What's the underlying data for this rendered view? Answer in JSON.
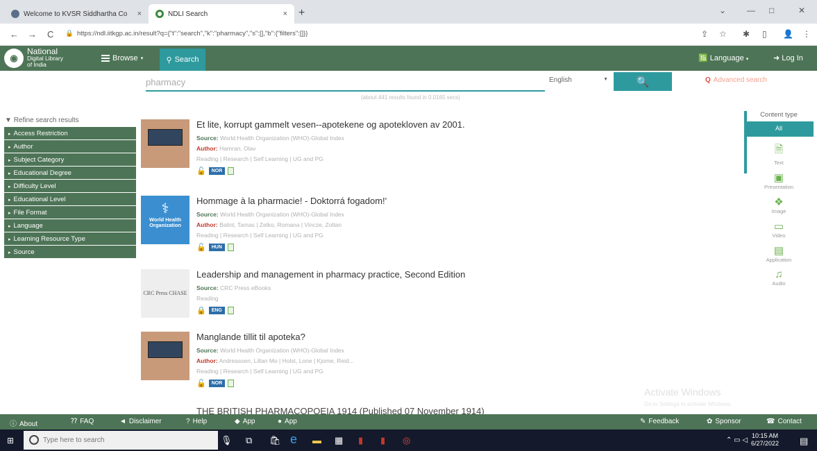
{
  "browser": {
    "tabs": [
      {
        "title": "Welcome to KVSR Siddhartha Co",
        "close": "×"
      },
      {
        "title": "NDLI Search",
        "close": "×"
      }
    ],
    "new_tab": "+",
    "url": "https://ndl.iitkgp.ac.in/result?q={\"t\":\"search\",\"k\":\"pharmacy\",\"s\":[],\"b\":{\"filters\":[]}}",
    "back": "←",
    "forward": "→",
    "reload": "C"
  },
  "header": {
    "logo_line1": "National",
    "logo_line2": "Digital Library",
    "logo_line3": "of India",
    "browse": "Browse",
    "search_tab": "Search",
    "language": "Language",
    "login": "Log In"
  },
  "search": {
    "query": "pharmacy",
    "language": "English",
    "advanced": "Advanced search",
    "results_info": "(about 441 results found in 0.0165 secs)"
  },
  "sidebar": {
    "title": "Refine search results",
    "facets": [
      "Access Restriction",
      "Author",
      "Subject Category",
      "Educational Degree",
      "Difficulty Level",
      "Educational Level",
      "File Format",
      "Language",
      "Learning Resource Type",
      "Source"
    ]
  },
  "results": [
    {
      "title": "Et lite, korrupt gammelt vesen--apotekene og apotekloven av 2001.",
      "source_label": "Source:",
      "source": "World Health Organization (WHO)-Global Index",
      "author_label": "Author:",
      "author": "Hamran, Olav",
      "tags": "Reading | Research | Self Learning | UG and PG",
      "lang": "NOR",
      "locked": false
    },
    {
      "title": "Hommage à la pharmacie! - Doktorrá fogadom!'",
      "source_label": "Source:",
      "source": "World Health Organization (WHO)-Global Index",
      "author_label": "Author:",
      "author": "Balint, Tamas | Zelko, Romana | Vincze, Zoltan",
      "tags": "Reading | Research | Self Learning | UG and PG",
      "lang": "HUN",
      "locked": false
    },
    {
      "title": "Leadership and management in pharmacy practice, Second Edition",
      "source_label": "Source:",
      "source": "CRC Press eBooks",
      "tags": "Reading",
      "lang": "ENG",
      "locked": true
    },
    {
      "title": "Manglande tillit til apoteka?",
      "source_label": "Source:",
      "source": "World Health Organization (WHO)-Global Index",
      "author_label": "Author:",
      "author": "Andreassen, Lillan Mo | Holst, Lone | Kjome, Reid...",
      "tags": "Reading | Research | Self Learning | UG and PG",
      "lang": "NOR",
      "locked": false
    }
  ],
  "partial_result_title": "THE BRITISH PHARMACOPOEIA 1914 (Published 07 November 1914)",
  "thumbs": {
    "who_text": "World Health Organization",
    "crc_text": "CRC Press CHASE"
  },
  "content_type": {
    "title": "Content type",
    "all": "All",
    "items": [
      {
        "label": "Text",
        "icon": "text-doc-icon"
      },
      {
        "label": "Presentation",
        "icon": "presentation-icon"
      },
      {
        "label": "Image",
        "icon": "image-icon"
      },
      {
        "label": "Video",
        "icon": "video-icon"
      },
      {
        "label": "Application",
        "icon": "application-icon"
      },
      {
        "label": "Audio",
        "icon": "audio-icon"
      }
    ]
  },
  "watermark": {
    "line1": "Activate Windows",
    "line2": "Go to Settings to activate Windows."
  },
  "footer": {
    "about": "About",
    "faq": "FAQ",
    "disclaimer": "Disclaimer",
    "help": "Help",
    "app1": "App",
    "app2": "App",
    "feedback": "Feedback",
    "sponsor": "Sponsor",
    "contact": "Contact"
  },
  "taskbar": {
    "search_placeholder": "Type here to search",
    "time": "10:15 AM",
    "date": "6/27/2022"
  },
  "colors": {
    "ndli_green": "#4d7456",
    "accent_teal": "#2e9a9e",
    "advanced_red": "#e14b3c"
  }
}
